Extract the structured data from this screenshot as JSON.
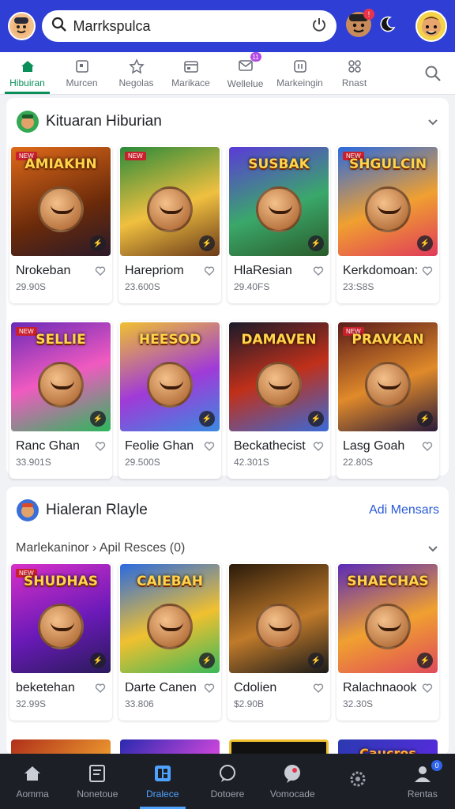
{
  "search": {
    "value": "Marrkspulca"
  },
  "category_tabs": [
    {
      "label": "Hibuiran",
      "icon": "home-icon"
    },
    {
      "label": "Murcen",
      "icon": "square-icon"
    },
    {
      "label": "Negolas",
      "icon": "star-icon"
    },
    {
      "label": "Marikace",
      "icon": "store-icon"
    },
    {
      "label": "Wellelue",
      "icon": "gift-icon"
    },
    {
      "label": "Markeingin",
      "icon": "gamepad-icon"
    },
    {
      "label": "Rnast",
      "icon": "grid-icon"
    }
  ],
  "section1": {
    "title": "Kituaran Hiburian",
    "cards": [
      {
        "title": "Nrokeban",
        "price": "29.90S",
        "art": "AMIAKHN",
        "tag": "NEW"
      },
      {
        "title": "Harepriom",
        "price": "23.600S",
        "art": "",
        "tag": "NEW"
      },
      {
        "title": "HlaResian",
        "price": "29.40FS",
        "art": "SUSBAK",
        "tag": ""
      },
      {
        "title": "Kerkdomoan:",
        "price": "23:S8S",
        "art": "SHGULCIN",
        "tag": "NEW"
      },
      {
        "title": "Ranc Ghan",
        "price": "33.901S",
        "art": "SELLIE",
        "tag": "NEW"
      },
      {
        "title": "Feolie Ghan",
        "price": "29.500S",
        "art": "HEESOD",
        "tag": ""
      },
      {
        "title": "Beckathecist",
        "price": "42.301S",
        "art": "DAMAVEN",
        "tag": ""
      },
      {
        "title": "Lasg Goah",
        "price": "22.80S",
        "art": "PRAVKAN",
        "tag": "NEW"
      }
    ]
  },
  "section2": {
    "title": "Hialeran Rlayle",
    "link": "Adi Mensars",
    "filter": "Marlekaninor  ›  Apil Resces  (0)",
    "cards": [
      {
        "title": "beketehan",
        "price": "32.99S",
        "art": "SHUDHAS",
        "tag": "NEW"
      },
      {
        "title": "Darte Canen",
        "price": "33.806",
        "art": "CAIEBAH",
        "tag": ""
      },
      {
        "title": "Cdolien",
        "price": "$2.90B",
        "art": "",
        "tag": ""
      },
      {
        "title": "Ralachnaook",
        "price": "32.30S",
        "art": "SHAECHAS",
        "tag": ""
      }
    ],
    "peek_art": "Caucros"
  },
  "bottom_nav": [
    {
      "label": "Aomma",
      "icon": "home-icon"
    },
    {
      "label": "Nonetoue",
      "icon": "book-icon"
    },
    {
      "label": "Dralece",
      "icon": "grid-icon"
    },
    {
      "label": "Dotoere",
      "icon": "chat-icon"
    },
    {
      "label": "Vomocade",
      "icon": "speaker-icon"
    },
    {
      "label": "",
      "icon": "settings-icon"
    },
    {
      "label": "Rentas",
      "icon": "profile-icon",
      "badge": "0"
    }
  ]
}
